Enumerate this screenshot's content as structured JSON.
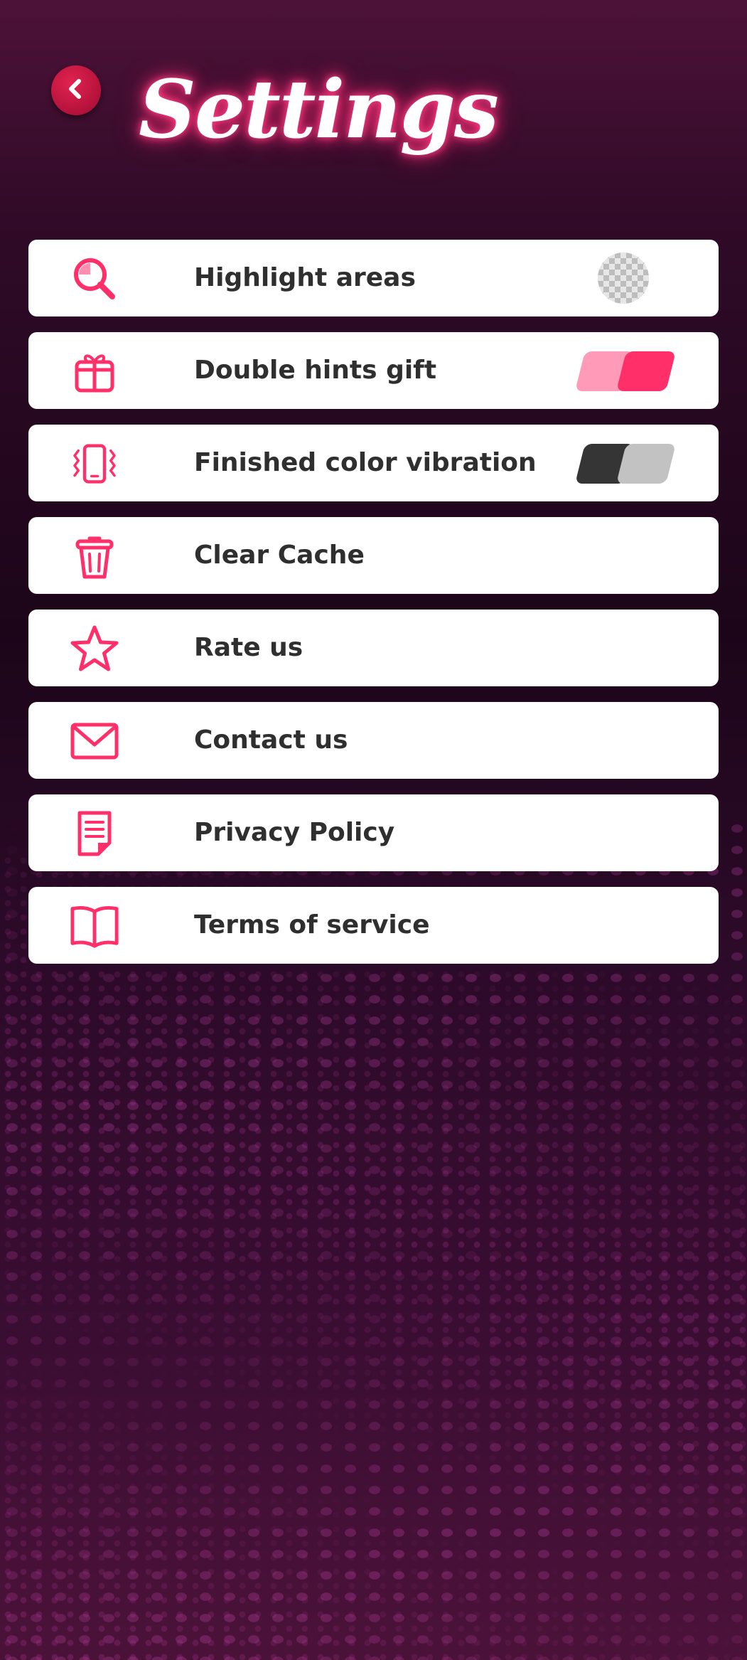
{
  "header": {
    "title": "Settings",
    "back_icon": "chevron-left-icon"
  },
  "colors": {
    "accent": "#ff2f6a",
    "accent_light": "#ff8fb0",
    "toggle_off_dark": "#353535",
    "toggle_off_light": "#c2c2c2",
    "row_background": "#ffffff",
    "text": "#2f2f2f"
  },
  "settings": [
    {
      "id": "highlight",
      "label": "Highlight areas",
      "icon": "magnifier-icon",
      "control": "color-swatch"
    },
    {
      "id": "double-hints",
      "label": "Double hints gift",
      "icon": "gift-icon",
      "control": "toggle",
      "on": true
    },
    {
      "id": "vibration",
      "label": "Finished color vibration",
      "icon": "phone-vibrate-icon",
      "control": "toggle",
      "on": false
    },
    {
      "id": "clear-cache",
      "label": "Clear Cache",
      "icon": "trash-icon"
    },
    {
      "id": "rate",
      "label": "Rate us",
      "icon": "star-icon"
    },
    {
      "id": "contact",
      "label": "Contact us",
      "icon": "envelope-icon"
    },
    {
      "id": "privacy",
      "label": "Privacy Policy",
      "icon": "document-icon"
    },
    {
      "id": "terms",
      "label": "Terms of service",
      "icon": "book-icon"
    }
  ]
}
